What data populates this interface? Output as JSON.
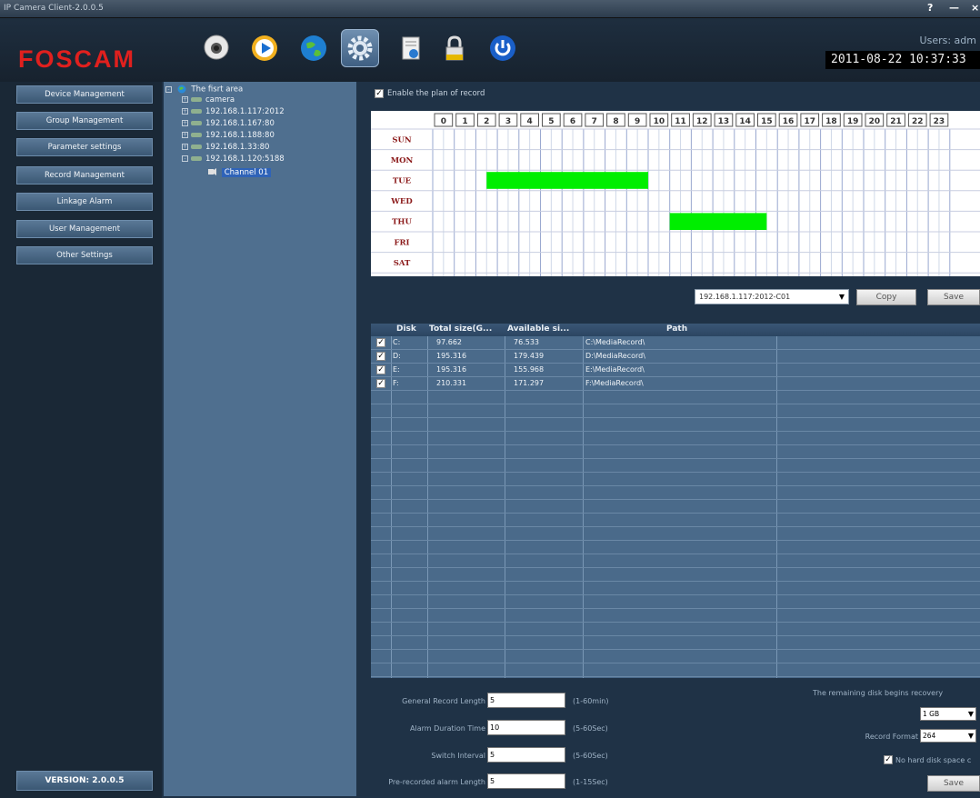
{
  "window": {
    "title": "IP Camera Client-2.0.0.5",
    "help": "?",
    "minimize": "—",
    "close": "×"
  },
  "header": {
    "logo": "FOSCAM",
    "users_label": "Users: adm",
    "datetime": "2011-08-22 10:37:33",
    "icons": [
      "camera-icon",
      "play-icon",
      "globe-icon",
      "gear-icon",
      "document-icon",
      "lock-icon",
      "power-icon"
    ]
  },
  "nav": {
    "items": [
      {
        "label": "Device Management"
      },
      {
        "label": "Group Management"
      },
      {
        "label": "Parameter settings"
      },
      {
        "label": "Record Management"
      },
      {
        "label": "Linkage Alarm"
      },
      {
        "label": "User Management"
      },
      {
        "label": "Other Settings"
      }
    ],
    "version": "VERSION: 2.0.0.5"
  },
  "tree": {
    "root": "The fisrt area",
    "nodes": [
      {
        "label": "camera"
      },
      {
        "label": "192.168.1.117:2012"
      },
      {
        "label": "192.168.1.167:80"
      },
      {
        "label": "192.168.1.188:80"
      },
      {
        "label": "192.168.1.33:80"
      },
      {
        "label": "192.168.1.120:5188"
      }
    ],
    "channel": "Channel 01"
  },
  "schedule": {
    "enable_label": "Enable the plan of record",
    "enabled": true,
    "hours": [
      "0",
      "1",
      "2",
      "3",
      "4",
      "5",
      "6",
      "7",
      "8",
      "9",
      "10",
      "11",
      "12",
      "13",
      "14",
      "15",
      "16",
      "17",
      "18",
      "19",
      "20",
      "21",
      "22",
      "23"
    ],
    "days": [
      "SUN",
      "MON",
      "TUE",
      "WED",
      "THU",
      "FRI",
      "SAT"
    ],
    "blocks": [
      {
        "day": "TUE",
        "start": 2.5,
        "end": 10
      },
      {
        "day": "THU",
        "start": 11,
        "end": 15.5
      }
    ],
    "accent": "#00ee00",
    "channel_value": "192.168.1.117:2012-C01",
    "copy_label": "Copy",
    "save_label": "Save"
  },
  "disks": {
    "columns": [
      "Disk",
      "Total size(G...",
      "Available si...",
      "Path"
    ],
    "rows": [
      {
        "disk": "C:",
        "total": "97.662",
        "avail": "76.533",
        "path": "C:\\MediaRecord\\",
        "checked": true
      },
      {
        "disk": "D:",
        "total": "195.316",
        "avail": "179.439",
        "path": "D:\\MediaRecord\\",
        "checked": true
      },
      {
        "disk": "E:",
        "total": "195.316",
        "avail": "155.968",
        "path": "E:\\MediaRecord\\",
        "checked": true
      },
      {
        "disk": "F:",
        "total": "210.331",
        "avail": "171.297",
        "path": "F:\\MediaRecord\\",
        "checked": true
      }
    ]
  },
  "form": {
    "general_label": "General Record Length",
    "general_value": "5",
    "general_hint": "(1-60min)",
    "alarm_label": "Alarm Duration Time",
    "alarm_value": "10",
    "alarm_hint": "(5-60Sec)",
    "switch_label": "Switch Interval",
    "switch_value": "5",
    "switch_hint": "(5-60Sec)",
    "prerec_label": "Pre-recorded alarm Length",
    "prerec_value": "5",
    "prerec_hint": "(1-15Sec)",
    "recovery_label": "The remaining disk begins recovery",
    "recovery_value": "1 GB",
    "format_label": "Record Format",
    "format_value": "264",
    "nohdd_label": "No hard disk space c",
    "save_label": "Save"
  }
}
